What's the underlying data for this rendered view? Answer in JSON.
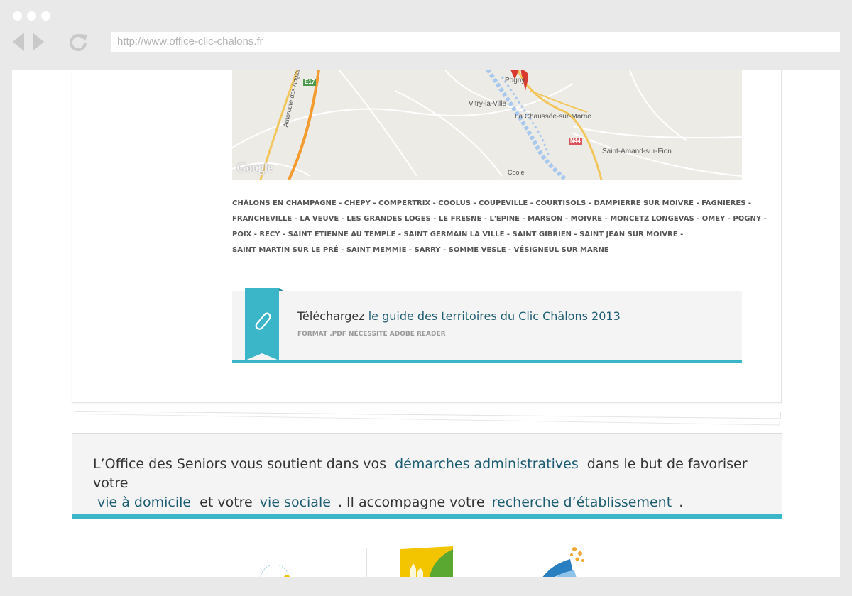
{
  "browser": {
    "url": "http://www.office-clic-chalons.fr"
  },
  "map": {
    "labels": {
      "vitry": "Vitry-la-Ville",
      "pogny": "Pogny",
      "chaussee": "La Chaussée-sur-Marne",
      "saint_amand": "Saint-Amand-sur-Fion",
      "autoroute": "Autoroute des Anglais",
      "coole": "Coole",
      "e17": "E17",
      "n44": "N44",
      "google": "Google"
    }
  },
  "communes": {
    "lines": [
      "CHÂLONS EN CHAMPAGNE - CHEPY - COMPERTRIX - COOLUS - COUPÉVILLE - COURTISOLS - DAMPIERRE SUR MOIVRE - FAGNIÈRES -",
      "FRANCHEVILLE - LA VEUVE - LES GRANDES LOGES - LE FRESNE - L'EPINE - MARSON - MOIVRE - MONCETZ LONGEVAS - OMEY - POGNY -",
      "POIX - RECY - SAINT ETIENNE AU TEMPLE - SAINT GERMAIN LA VILLE - SAINT GIBRIEN - SAINT JEAN SUR MOIVRE -",
      "SAINT MARTIN SUR LE PRÉ - SAINT MEMMIE - SARRY - SOMME VESLE - VÉSIGNEUL SUR MARNE"
    ]
  },
  "download": {
    "prefix": "Téléchargez",
    "link": "le guide des territoires du Clic Châlons 2013",
    "subtitle": "FORMAT .PDF NÉCESSITE ADOBE READER"
  },
  "info": {
    "part1": "L’Office des Seniors vous soutient dans vos",
    "link1": "démarches administratives",
    "part2": "dans le but de favoriser votre",
    "link2": "vie à domicile",
    "part3": "et votre",
    "link3": "vie sociale",
    "part4": ". Il accompagne votre",
    "link4": "recherche d’établissement",
    "part5": "."
  },
  "colors": {
    "accent": "#3bb6c9",
    "link": "#1d5d72",
    "chrome": "#e9e9e9"
  }
}
